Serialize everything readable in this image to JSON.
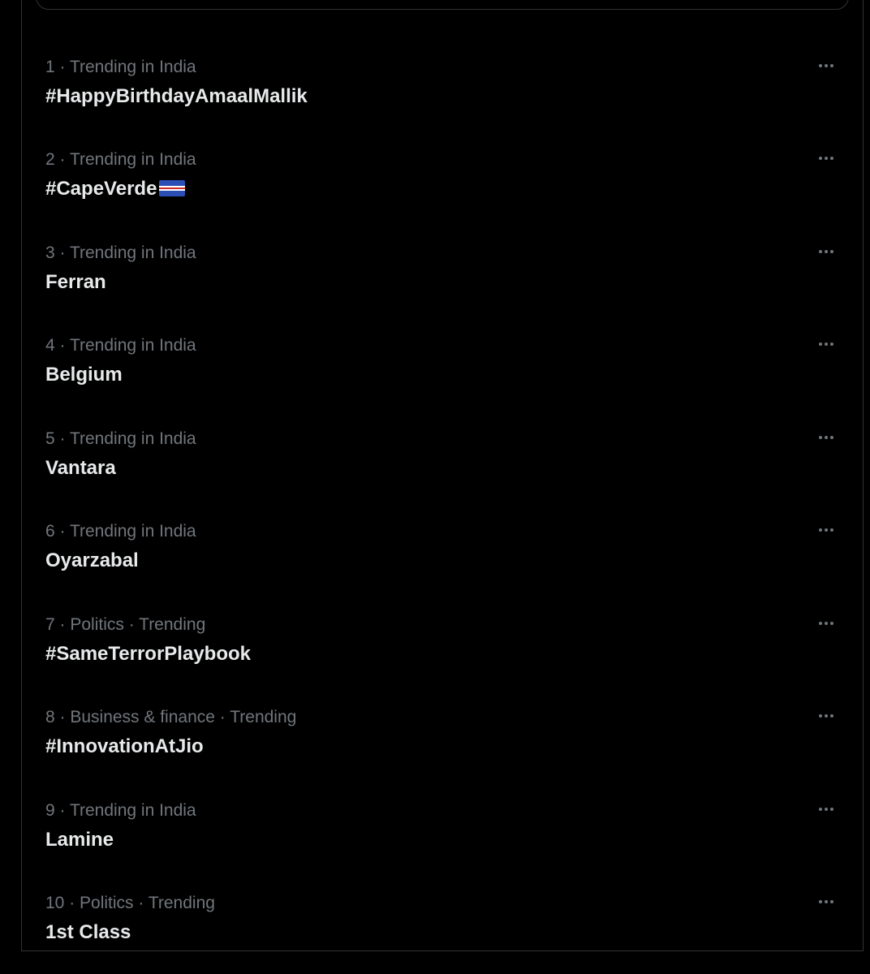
{
  "trends": [
    {
      "meta": "1 · Trending in India",
      "name": "#HappyBirthdayAmaalMallik"
    },
    {
      "meta": "2 · Trending in India",
      "name": "#CapeVerde",
      "flag": "cape-verde-flag"
    },
    {
      "meta": "3 · Trending in India",
      "name": "Ferran"
    },
    {
      "meta": "4 · Trending in India",
      "name": "Belgium"
    },
    {
      "meta": "5 · Trending in India",
      "name": "Vantara"
    },
    {
      "meta": "6 · Trending in India",
      "name": "Oyarzabal"
    },
    {
      "meta": "7 · Politics · Trending",
      "name": "#SameTerrorPlaybook"
    },
    {
      "meta": "8 · Business & finance · Trending",
      "name": "#InnovationAtJio"
    },
    {
      "meta": "9 · Trending in India",
      "name": "Lamine"
    },
    {
      "meta": "10 · Politics · Trending",
      "name": "1st Class"
    }
  ],
  "icons": {
    "more": "more-icon"
  },
  "colors": {
    "background": "#000000",
    "meta_text": "#71767b",
    "name_text": "#e7e9ea",
    "divider": "#2f3336"
  }
}
